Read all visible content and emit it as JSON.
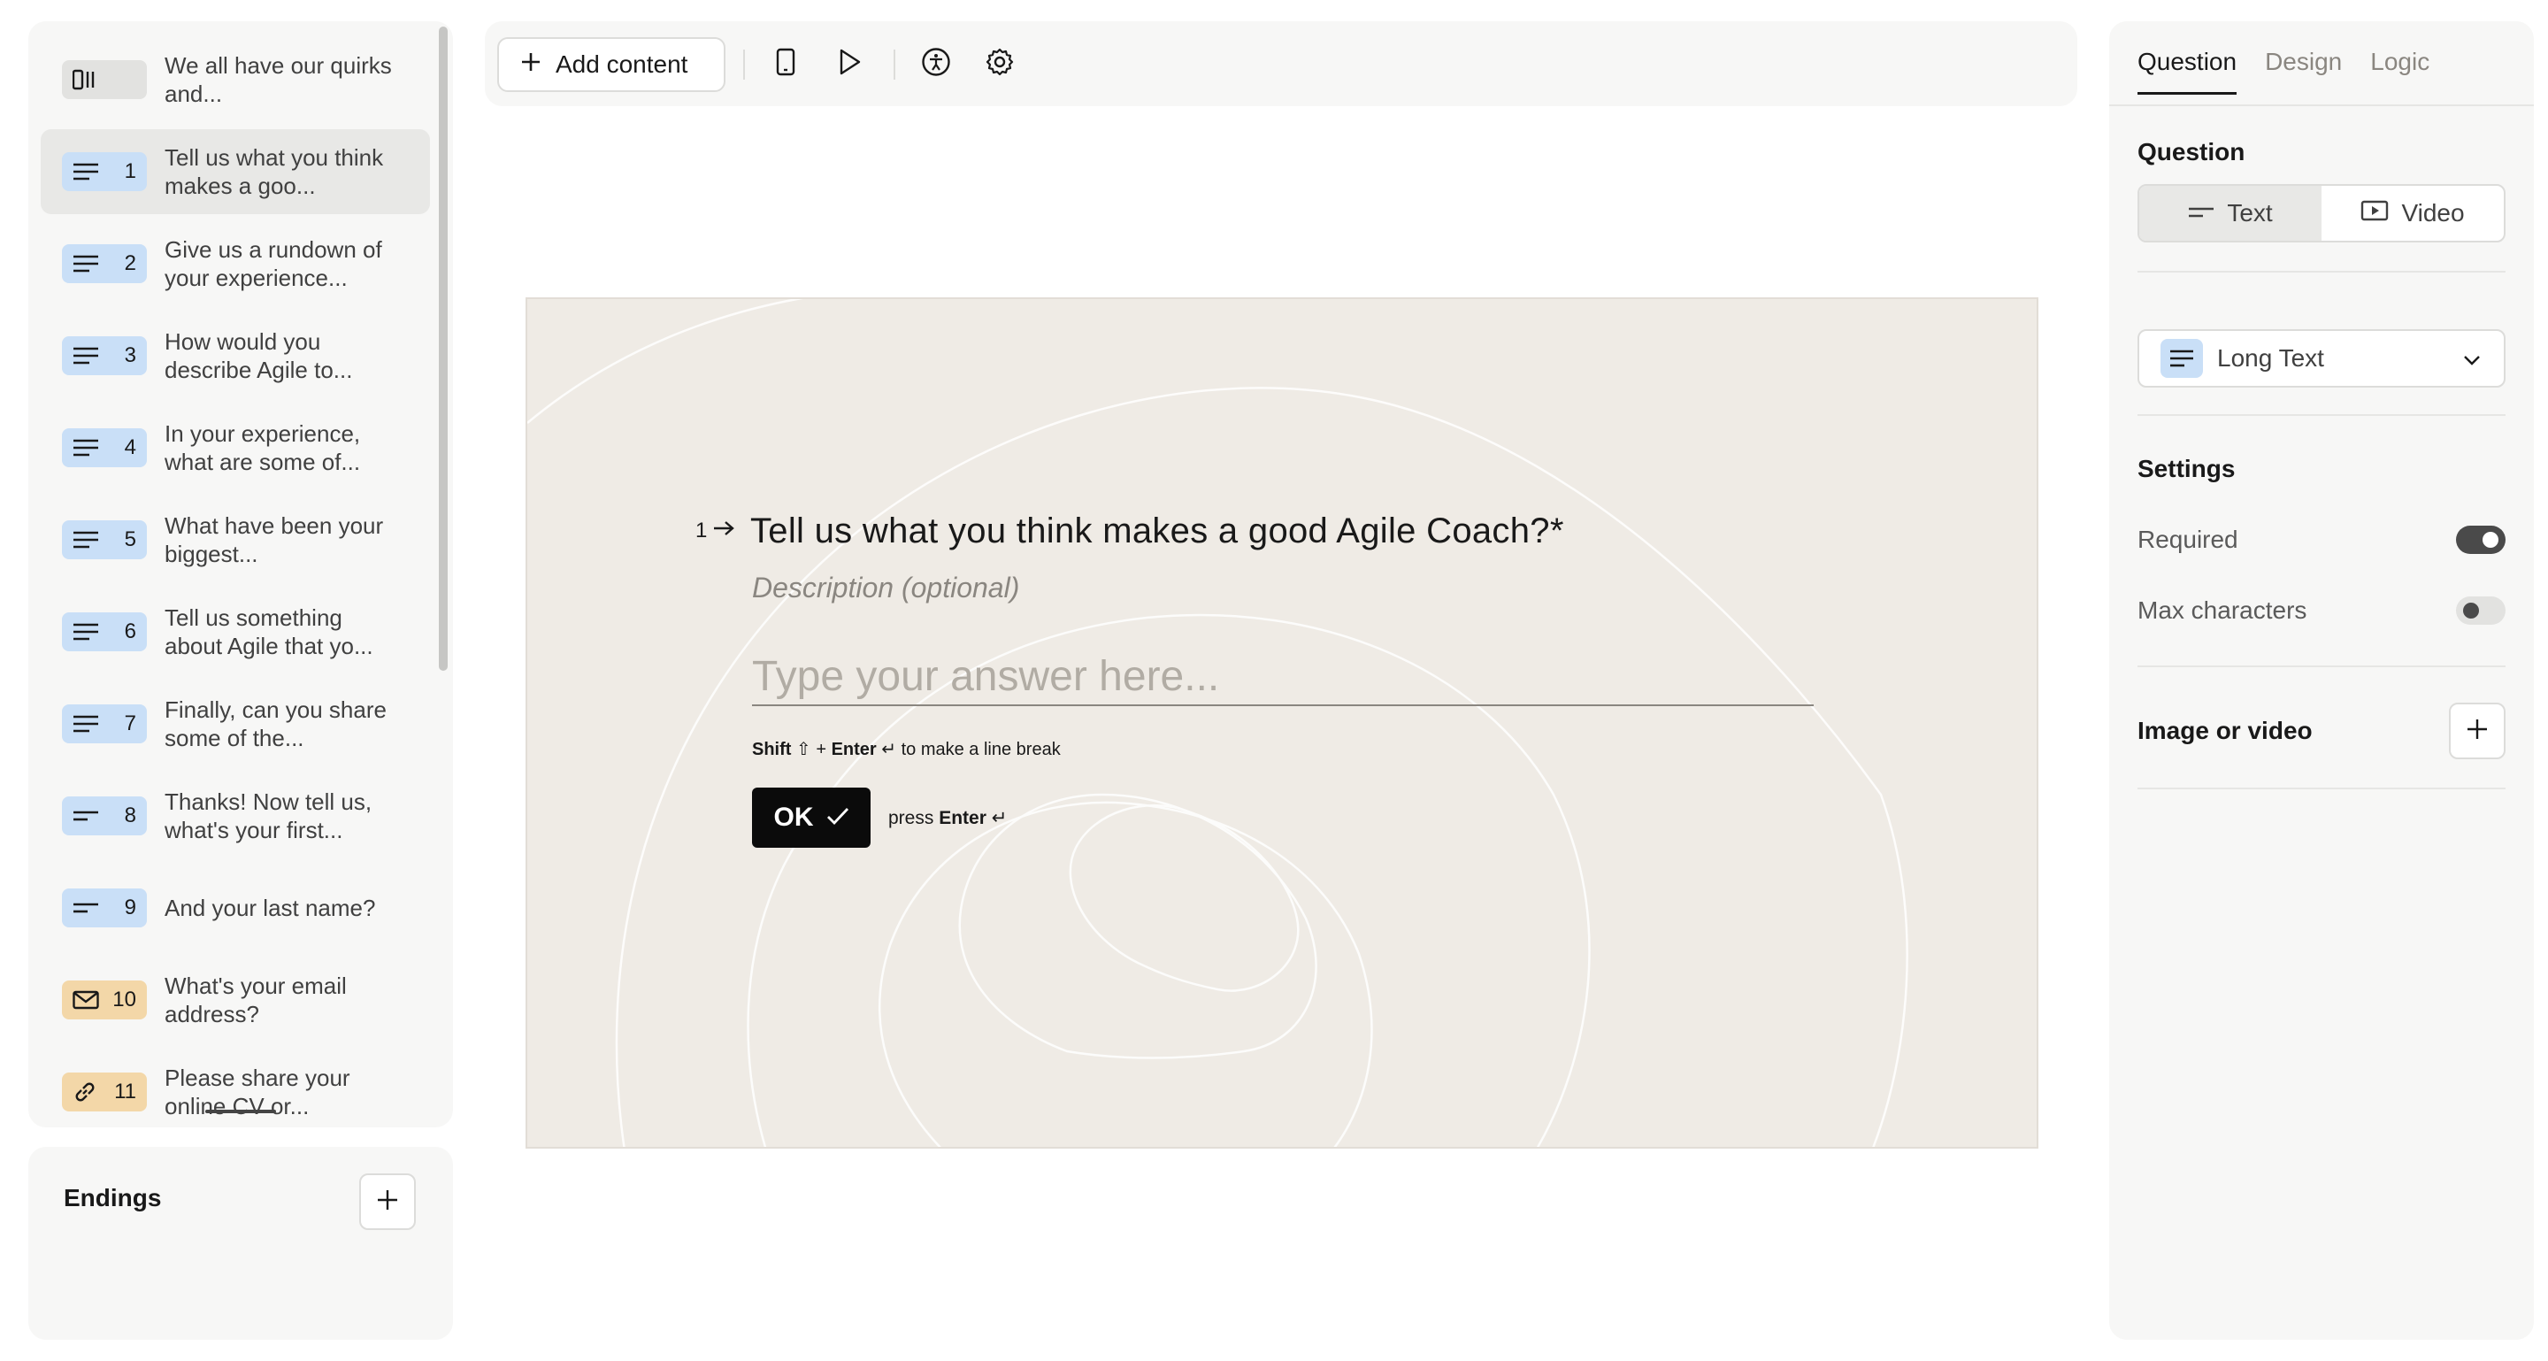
{
  "sidebar": {
    "questions": [
      {
        "number": "",
        "text": "We all have our quirks and...",
        "icon": "statement-icon",
        "badge_color": "#e2e2e0"
      },
      {
        "number": "1",
        "text": "Tell us what you think makes a goo...",
        "icon": "long-text-icon",
        "badge_color": "#c9dff7"
      },
      {
        "number": "2",
        "text": "Give us a rundown of your experience...",
        "icon": "long-text-icon",
        "badge_color": "#c9dff7"
      },
      {
        "number": "3",
        "text": "How would you describe Agile to...",
        "icon": "long-text-icon",
        "badge_color": "#c9dff7"
      },
      {
        "number": "4",
        "text": "In your experience, what are some of...",
        "icon": "long-text-icon",
        "badge_color": "#c9dff7"
      },
      {
        "number": "5",
        "text": "What have been your biggest...",
        "icon": "long-text-icon",
        "badge_color": "#c9dff7"
      },
      {
        "number": "6",
        "text": "Tell us something about Agile that yo...",
        "icon": "long-text-icon",
        "badge_color": "#c9dff7"
      },
      {
        "number": "7",
        "text": "Finally, can you share some of the...",
        "icon": "long-text-icon",
        "badge_color": "#c9dff7"
      },
      {
        "number": "8",
        "text": "Thanks! Now tell us, what's your first...",
        "icon": "short-text-icon",
        "badge_color": "#c9dff7"
      },
      {
        "number": "9",
        "text": "And your last name?",
        "icon": "short-text-icon",
        "badge_color": "#c9dff7"
      },
      {
        "number": "10",
        "text": "What's your email address?",
        "icon": "email-icon",
        "badge_color": "#f3d7a8"
      },
      {
        "number": "11",
        "text": "Please share your online CV or...",
        "icon": "link-icon",
        "badge_color": "#f3d7a8"
      }
    ],
    "active_index": 1
  },
  "endings": {
    "title": "Endings"
  },
  "toolbar": {
    "add_content_label": "Add content"
  },
  "canvas": {
    "question_number": "1",
    "question_title": "Tell us what you think makes a good Agile Coach?*",
    "description_placeholder": "Description (optional)",
    "answer_placeholder": "Type your answer here...",
    "hint_key_shift": "Shift",
    "hint_key_enter": "Enter",
    "hint_plus": "+",
    "hint_suffix": "to make a line break",
    "ok_label": "OK",
    "press_label": "press",
    "press_key": "Enter"
  },
  "right_panel": {
    "tabs": [
      "Question",
      "Design",
      "Logic"
    ],
    "active_tab": 0,
    "question_section_label": "Question",
    "mode_text_label": "Text",
    "mode_video_label": "Video",
    "type_label": "Long Text",
    "settings_label": "Settings",
    "required_label": "Required",
    "required_on": true,
    "max_chars_label": "Max characters",
    "max_chars_on": false,
    "media_label": "Image or video"
  },
  "colors": {
    "accent_blue": "#c9dff7",
    "accent_orange": "#f3d7a8",
    "canvas_bg": "#efebe5",
    "ok_button": "#0b0b0b"
  }
}
